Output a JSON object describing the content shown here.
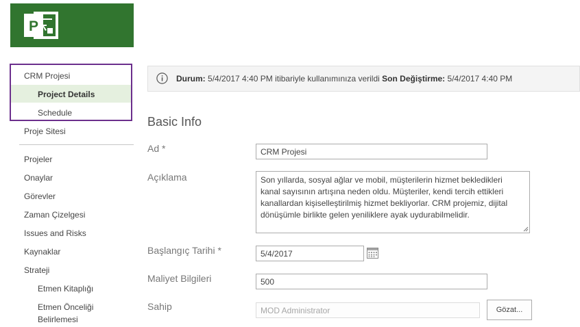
{
  "app": {
    "logo": "project-logo",
    "brand_color": "#31752f",
    "accent_color": "#6b2e8c"
  },
  "nav": {
    "project_name": "CRM Projesi",
    "project_details": "Project Details",
    "schedule": "Schedule",
    "project_site": "Proje Sitesi",
    "items": [
      "Projeler",
      "Onaylar",
      "Görevler",
      "Zaman Çizelgesi",
      "Issues and Risks",
      "Kaynaklar",
      "Strateji"
    ],
    "strategy_sub": {
      "drivers_library": "Etmen Kitaplığı",
      "driver_priority_line1": "Etmen Önceliği",
      "driver_priority_line2": "Belirlemesi"
    }
  },
  "status": {
    "icon": "info-icon",
    "status_label": "Durum:",
    "status_value": "5/4/2017 4:40 PM itibariyle kullanımınıza verildi",
    "modified_label": "Son Değiştirme:",
    "modified_value": "5/4/2017 4:40 PM"
  },
  "section_title": "Basic Info",
  "form": {
    "name_label": "Ad *",
    "name_value": "CRM Projesi",
    "description_label": "Açıklama",
    "description_lines": [
      "Son yıllarda, sosyal ağlar ve mobil, müşterilerin hizmet bekledikleri",
      "kanal sayısının artışına neden oldu. Müşteriler, kendi tercih ettikleri",
      "kanallardan kişiselleştirilmiş hizmet bekliyorlar. CRM projemiz, dijital",
      "dönüşümle birlikte gelen yeniliklere ayak uydurabilmelidir."
    ],
    "start_label": "Başlangıç Tarihi *",
    "start_value": "5/4/2017",
    "cost_label": "Maliyet Bilgileri",
    "cost_value": "500",
    "owner_label": "Sahip",
    "owner_value": "MOD Administrator",
    "browse_label": "Gözat..."
  }
}
